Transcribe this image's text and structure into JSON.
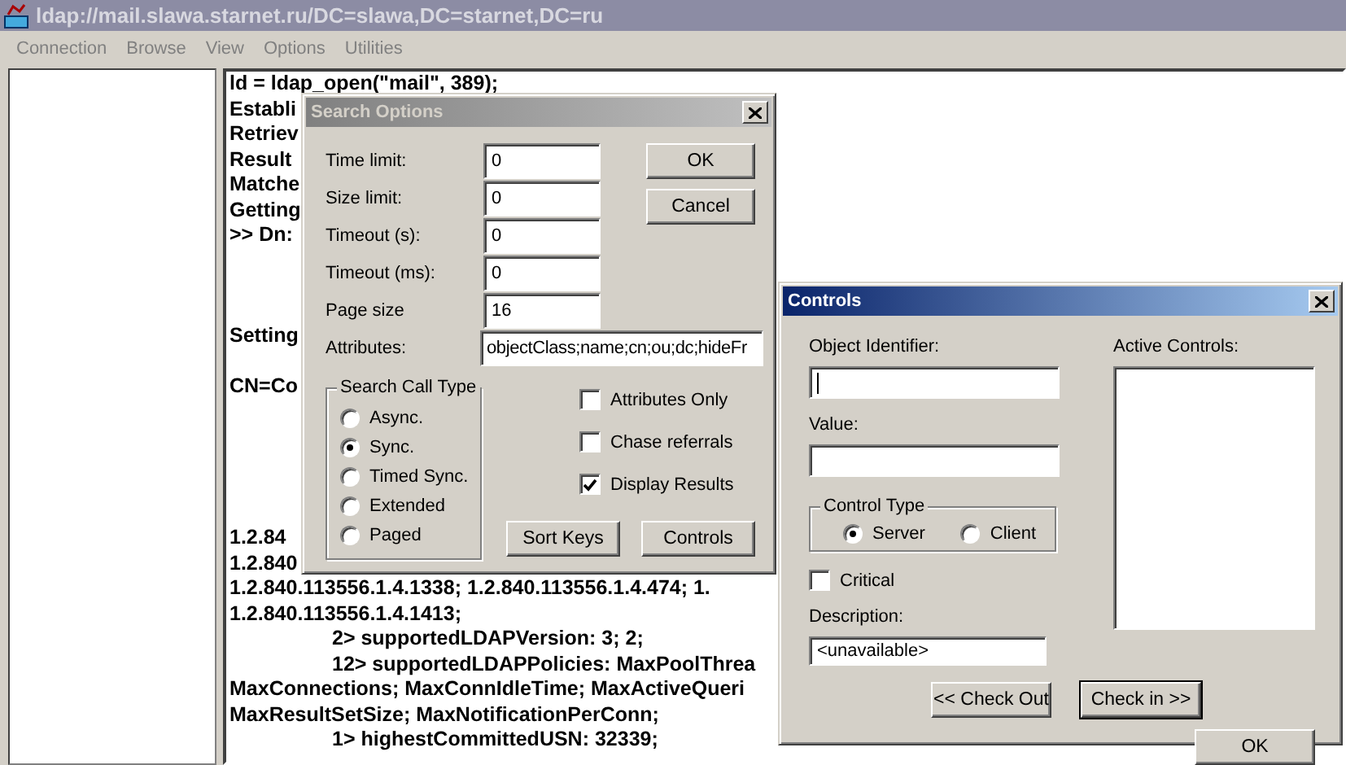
{
  "window": {
    "title": "ldap://mail.slawa.starnet.ru/DC=slawa,DC=starnet,DC=ru",
    "active": false
  },
  "menu": [
    "Connection",
    "Browse",
    "View",
    "Options",
    "Utilities"
  ],
  "output_lines": [
    {
      "kind": "text",
      "text": "ld = ldap_open(\"mail\", 389);"
    },
    {
      "kind": "text",
      "text": "Establi"
    },
    {
      "kind": "text",
      "text": "Retriev"
    },
    {
      "kind": "text",
      "text": "Result"
    },
    {
      "kind": "text",
      "text": "Matche"
    },
    {
      "kind": "text",
      "text": "Getting"
    },
    {
      "kind": "text",
      "text": ">> Dn:"
    },
    {
      "kind": "covered"
    },
    {
      "kind": "covered"
    },
    {
      "kind": "covered"
    },
    {
      "kind": "text",
      "text": "Setting"
    },
    {
      "kind": "covered"
    },
    {
      "kind": "text",
      "text": "CN=Co"
    },
    {
      "kind": "covered"
    },
    {
      "kind": "covered"
    },
    {
      "kind": "covered"
    },
    {
      "kind": "covered"
    },
    {
      "kind": "covered"
    },
    {
      "kind": "text",
      "text": "1.2.84"
    },
    {
      "kind": "text",
      "text": "1.2.840"
    },
    {
      "kind": "text",
      "text": "1.2.840.113556.1.4.1338; 1.2.840.113556.1.4.474; 1."
    },
    {
      "kind": "text",
      "text": "1.2.840.113556.1.4.1413;"
    },
    {
      "kind": "indented",
      "text": "2> supportedLDAPVersion: 3; 2;"
    },
    {
      "kind": "indented",
      "text": "12> supportedLDAPPolicies: MaxPoolThrea"
    },
    {
      "kind": "text",
      "text": "MaxConnections; MaxConnIdleTime; MaxActiveQueri"
    },
    {
      "kind": "text",
      "text": "MaxResultSetSize; MaxNotificationPerConn;"
    },
    {
      "kind": "indented",
      "text": "1> highestCommittedUSN: 32339;"
    }
  ],
  "search_options": {
    "title": "Search Options",
    "active": false,
    "fields": [
      {
        "label": "Time limit:",
        "value": "0"
      },
      {
        "label": "Size limit:",
        "value": "0"
      },
      {
        "label": "Timeout (s):",
        "value": "0"
      },
      {
        "label": "Timeout (ms):",
        "value": "0"
      },
      {
        "label": "Page size",
        "value": "16"
      }
    ],
    "attributes": {
      "label": "Attributes:",
      "value": "objectClass;name;cn;ou;dc;hideFr"
    },
    "buttons": [
      {
        "label": "OK"
      },
      {
        "label": "Cancel"
      }
    ],
    "search_call_type": {
      "label": "Search Call Type",
      "options": [
        {
          "label": "Async.",
          "selected": false
        },
        {
          "label": "Sync.",
          "selected": true
        },
        {
          "label": "Timed Sync.",
          "selected": false
        },
        {
          "label": "Extended",
          "selected": false
        },
        {
          "label": "Paged",
          "selected": false
        }
      ]
    },
    "checkboxes": [
      {
        "label": "Attributes Only",
        "checked": false
      },
      {
        "label": "Chase referrals",
        "checked": false
      },
      {
        "label": "Display Results",
        "checked": true
      }
    ],
    "bottom_buttons": [
      {
        "label": "Sort Keys"
      },
      {
        "label": "Controls"
      }
    ]
  },
  "controls_dialog": {
    "title": "Controls",
    "active": true,
    "object_identifier": {
      "label": "Object Identifier:",
      "focused": true
    },
    "value": {
      "label": "Value:"
    },
    "control_type": {
      "label": "Control Type",
      "options": [
        {
          "label": "Server",
          "selected": true
        },
        {
          "label": "Client",
          "selected": false
        }
      ]
    },
    "critical": {
      "label": "Critical",
      "checked": false
    },
    "description": {
      "label": "Description:",
      "value": "<unavailable>"
    },
    "active_controls": {
      "label": "Active Controls:"
    },
    "buttons": [
      {
        "label": "<< Check Out",
        "default": false
      },
      {
        "label": "Check in >>",
        "default": true
      }
    ],
    "ok_button": {
      "label": "OK"
    }
  }
}
